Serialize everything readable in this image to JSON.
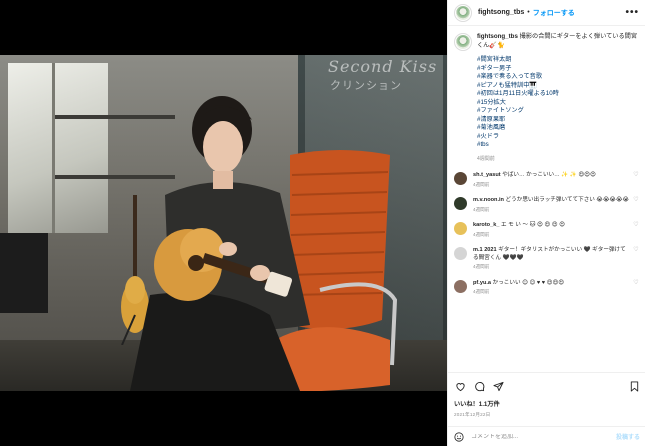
{
  "account": {
    "username": "fightsong_tbs",
    "separator": "•",
    "follow_label": "フォローする",
    "more_label": "•••"
  },
  "caption": {
    "username": "fightsong_tbs",
    "text": "撮影の合間にギターをよく弾いている間宮くん🎸🐈",
    "hashtags": [
      "#間宮祥太朗",
      "#ギター男子",
      "#楽器で奏る入って音歌",
      "#ピアノも猛特訓中🎹",
      "#初回は1月11日火曜よる10時",
      "#15分拡大",
      "#ファイトソング",
      "#清原果耶",
      "#菊池風磨",
      "#火ドラ",
      "#tbs"
    ],
    "meta": "4週間前"
  },
  "photo_overlay": {
    "wall_text_1": "Second Kiss",
    "wall_text_2": "クリンション"
  },
  "comments": [
    {
      "user": "sh.t_yasut",
      "text": "やばい… かっこいい… ✨ ✨ 😍😍😍",
      "meta": "4週間前",
      "avatar_color": "#5a4636"
    },
    {
      "user": "m.v.noon.in",
      "text": "どうか思い出ラッチ弾いてて下さい 😭😭😭😭😭",
      "meta": "4週間前",
      "avatar_color": "#2f3a2a"
    },
    {
      "user": "karoto_k_",
      "text": "エ モ い 〜 🐱 😍 😍 😍 😍",
      "meta": "4週間前",
      "avatar_color": "#e7c15a"
    },
    {
      "user": "m.1 2021",
      "text": "ギター！ギタリストがかっこいい 🖤 ギター弾けてる間宮くん 🖤🖤🖤",
      "meta": "4週間前",
      "avatar_color": "#d5d5d5"
    },
    {
      "user": "pf.yu.a",
      "text": "かっこいい 😊 😊 ♥ ♥ 😍😍😍",
      "meta": "4週間前",
      "avatar_color": "#8c6f62"
    }
  ],
  "likes": "いいね！1.1万件",
  "date": "2021年12月22日",
  "comment_box": {
    "placeholder": "コメントを追加...",
    "post_label": "投稿する"
  },
  "colors": {
    "follow_blue": "#0095f6",
    "hashtag_blue": "#00376b",
    "muted_gray": "#8e8e8e",
    "chair_orange": "#d8622a"
  },
  "icons": [
    "more-icon",
    "heart-icon",
    "comment-icon",
    "share-icon",
    "bookmark-icon",
    "emoji-icon",
    "user-tag-icon"
  ]
}
